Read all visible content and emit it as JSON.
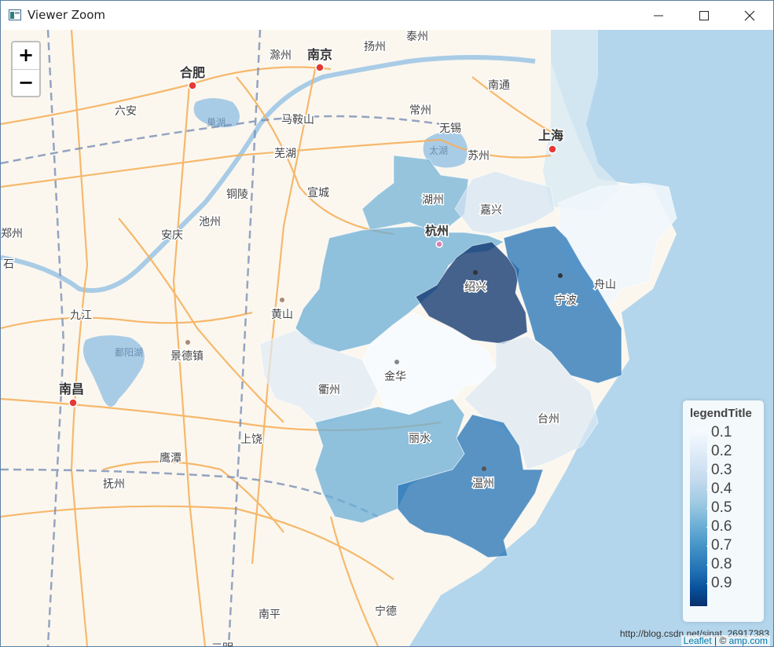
{
  "window": {
    "title": "Viewer Zoom",
    "controls": [
      "minimize",
      "maximize",
      "close"
    ]
  },
  "map": {
    "zoom_in_label": "+",
    "zoom_out_label": "−",
    "city_labels": [
      {
        "name": "泰州"
      },
      {
        "name": "扬州"
      },
      {
        "name": "滁州"
      },
      {
        "name": "南京",
        "major": true
      },
      {
        "name": "合肥",
        "major": true
      },
      {
        "name": "六安"
      },
      {
        "name": "巢湖",
        "water": true
      },
      {
        "name": "马鞍山"
      },
      {
        "name": "常州"
      },
      {
        "name": "南通"
      },
      {
        "name": "无锡"
      },
      {
        "name": "太湖",
        "water": true
      },
      {
        "name": "苏州"
      },
      {
        "name": "上海",
        "major": true
      },
      {
        "name": "芜湖"
      },
      {
        "name": "铜陵"
      },
      {
        "name": "宣城"
      },
      {
        "name": "湖州"
      },
      {
        "name": "嘉兴"
      },
      {
        "name": "池州"
      },
      {
        "name": "安庆"
      },
      {
        "name": "杭州",
        "major": true
      },
      {
        "name": "郑州"
      },
      {
        "name": "石"
      },
      {
        "name": "绍兴"
      },
      {
        "name": "舟山"
      },
      {
        "name": "宁波"
      },
      {
        "name": "九江"
      },
      {
        "name": "黄山"
      },
      {
        "name": "鄱阳湖",
        "water": true
      },
      {
        "name": "景德镇"
      },
      {
        "name": "衢州"
      },
      {
        "name": "金华"
      },
      {
        "name": "南昌",
        "major": true
      },
      {
        "name": "台州"
      },
      {
        "name": "丽水"
      },
      {
        "name": "上饶"
      },
      {
        "name": "鹰潭"
      },
      {
        "name": "抚州"
      },
      {
        "name": "温州"
      },
      {
        "name": "宁德"
      },
      {
        "name": "南平"
      },
      {
        "name": "三明"
      }
    ],
    "regions": [
      {
        "name": "湖州",
        "value": 0.5
      },
      {
        "name": "嘉兴",
        "value": 0.25
      },
      {
        "name": "杭州",
        "value": 0.5
      },
      {
        "name": "舟山",
        "value": 0.1
      },
      {
        "name": "绍兴",
        "value": 0.9
      },
      {
        "name": "宁波",
        "value": 0.75
      },
      {
        "name": "衢州",
        "value": 0.2
      },
      {
        "name": "金华",
        "value": 0.1
      },
      {
        "name": "台州",
        "value": 0.25
      },
      {
        "name": "丽水",
        "value": 0.55
      },
      {
        "name": "温州",
        "value": 0.72
      }
    ]
  },
  "legend": {
    "title": "legendTitle",
    "labels": [
      "0.1",
      "0.2",
      "0.3",
      "0.4",
      "0.5",
      "0.6",
      "0.7",
      "0.8",
      "0.9"
    ],
    "palette": [
      "#f7fbff",
      "#08306b"
    ]
  },
  "credit": "http://blog.csdn.net/sinat_26917383",
  "attribution": {
    "leaflet": "Leaflet",
    "separator": " | © ",
    "amap": "amp.com"
  }
}
